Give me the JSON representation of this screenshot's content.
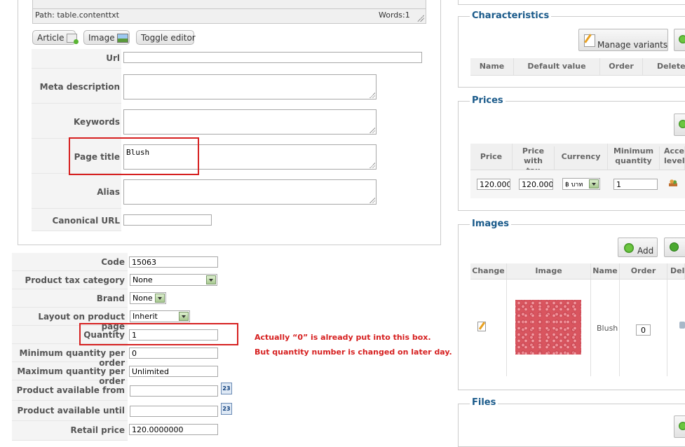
{
  "editor": {
    "path_text": "Path: table.contenttxt",
    "words_text": "Words:1",
    "buttons": {
      "article": "Article",
      "image": "Image",
      "toggle": "Toggle editor"
    }
  },
  "meta_fields": {
    "url": {
      "label": "Url",
      "value": ""
    },
    "meta_description": {
      "label": "Meta description",
      "value": ""
    },
    "keywords": {
      "label": "Keywords",
      "value": ""
    },
    "page_title": {
      "label": "Page title",
      "value": "Blush"
    },
    "alias": {
      "label": "Alias",
      "value": ""
    },
    "canonical_url": {
      "label": "Canonical URL",
      "value": ""
    }
  },
  "product_fields": {
    "code": {
      "label": "Code",
      "value": "15063"
    },
    "tax_category": {
      "label": "Product tax category",
      "value": "None"
    },
    "brand": {
      "label": "Brand",
      "value": "None"
    },
    "layout": {
      "label": "Layout on product page",
      "value": "Inherit"
    },
    "quantity": {
      "label": "Quantity",
      "value": "1"
    },
    "min_qty": {
      "label": "Minimum quantity per order",
      "value": "0"
    },
    "max_qty": {
      "label": "Maximum quantity per order",
      "value": "Unlimited"
    },
    "available_from": {
      "label": "Product available from",
      "value": ""
    },
    "available_until": {
      "label": "Product available until",
      "value": ""
    },
    "retail_price": {
      "label": "Retail price",
      "value": "120.0000000"
    },
    "calendar_day": "23"
  },
  "annotation": {
    "line1": "Actually “0” is already put into this box.",
    "line2": "But quantity number is changed on later day."
  },
  "characteristics": {
    "title": "Characteristics",
    "manage_variants": "Manage variants",
    "columns": [
      "Name",
      "Default value",
      "Order",
      "Delete"
    ]
  },
  "prices": {
    "title": "Prices",
    "columns": [
      "Price",
      "Price with tax",
      "Currency",
      "Minimum quantity",
      "Access level"
    ],
    "row": {
      "price": "120.0000",
      "price_with_tax": "120.0000",
      "currency": "฿ บาท",
      "min_qty": "1"
    }
  },
  "images": {
    "title": "Images",
    "add_label": "Add",
    "columns": [
      "Change",
      "Image",
      "Name",
      "Order",
      "Delete"
    ],
    "row": {
      "name": "Blush",
      "order": "0"
    }
  },
  "files": {
    "title": "Files"
  },
  "colors": {
    "legend": "#1a5a8a",
    "annotation": "#d62020",
    "swatch": "#e0606a"
  }
}
